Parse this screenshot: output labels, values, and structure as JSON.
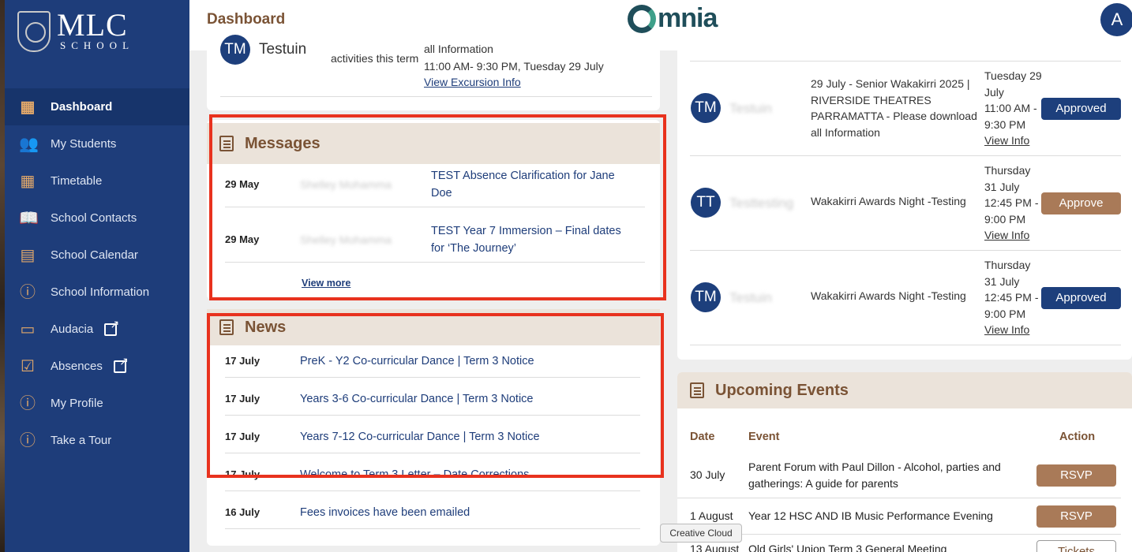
{
  "app": {
    "logo_main": "MLC",
    "logo_sub": "SCHOOL",
    "page_title": "Dashboard",
    "brand": "mnia",
    "avatar_initial": "A"
  },
  "sidebar": {
    "items": [
      {
        "label": "Dashboard",
        "icon": "dashboard-icon",
        "glyph": "▦"
      },
      {
        "label": "My Students",
        "icon": "students-icon",
        "glyph": "👥"
      },
      {
        "label": "Timetable",
        "icon": "timetable-icon",
        "glyph": "▦"
      },
      {
        "label": "School Contacts",
        "icon": "contacts-icon",
        "glyph": "📖"
      },
      {
        "label": "School Calendar",
        "icon": "calendar-icon",
        "glyph": "▤"
      },
      {
        "label": "School Information",
        "icon": "info-icon",
        "glyph": "ⓘ"
      },
      {
        "label": "Audacia",
        "icon": "audacia-icon",
        "glyph": "▭"
      },
      {
        "label": "Absences",
        "icon": "absences-icon",
        "glyph": "☑"
      },
      {
        "label": "My Profile",
        "icon": "profile-icon",
        "glyph": "ⓘ"
      },
      {
        "label": "Take a Tour",
        "icon": "tour-icon",
        "glyph": "ⓘ"
      }
    ]
  },
  "top_card": {
    "avatar": "TM",
    "name": "Testuin",
    "col1": "activities this term",
    "line1": "all Information",
    "line2": "11:00 AM- 9:30 PM, Tuesday 29 July",
    "link": "View Excursion Info"
  },
  "messages": {
    "title": "Messages",
    "items": [
      {
        "date": "29 May",
        "sender": "Shelley Mohamma",
        "subject": "TEST Absence Clarification for Jane Doe"
      },
      {
        "date": "29 May",
        "sender": "Shelley Mohamma",
        "subject": "TEST Year 7 Immersion – Final dates for ‘The Journey’"
      }
    ],
    "view_more": "View more"
  },
  "news": {
    "title": "News",
    "items": [
      {
        "date": "17 July",
        "title": "PreK - Y2 Co-curricular Dance | Term 3 Notice"
      },
      {
        "date": "17 July",
        "title": "Years 3-6 Co-curricular Dance | Term 3 Notice"
      },
      {
        "date": "17 July",
        "title": "Years 7-12 Co-curricular Dance | Term 3 Notice"
      },
      {
        "date": "17 July",
        "title": "Welcome to Term 3 Letter – Date Corrections"
      },
      {
        "date": "16 July",
        "title": "Fees invoices have been emailed"
      }
    ]
  },
  "approvals": {
    "items": [
      {
        "avatar": "TM",
        "name": "Testuin",
        "event": "29 July - Senior Wakakirri 2025 | RIVERSIDE THEATRES PARRAMATTA - Please download all Information",
        "when": [
          "Tuesday 29",
          "July",
          "11:00 AM -",
          "9:30 PM"
        ],
        "link": "View Info",
        "action": "Approved"
      },
      {
        "avatar": "TT",
        "name": "Testtesting",
        "event": "Wakakirri Awards Night -Testing",
        "when": [
          "Thursday",
          "31 July",
          "12:45 PM -",
          "9:00 PM"
        ],
        "link": "View Info",
        "action": "Approve"
      },
      {
        "avatar": "TM",
        "name": "Testuin",
        "event": "Wakakirri Awards Night -Testing",
        "when": [
          "Thursday",
          "31 July",
          "12:45 PM -",
          "9:00 PM"
        ],
        "link": "View Info",
        "action": "Approved"
      }
    ]
  },
  "events": {
    "title": "Upcoming Events",
    "headers": {
      "date": "Date",
      "event": "Event",
      "action": "Action"
    },
    "items": [
      {
        "date": "30 July",
        "event": "Parent Forum with Paul Dillon - Alcohol, parties and gatherings: A guide for parents",
        "action": "RSVP"
      },
      {
        "date": "1 August",
        "event": "Year 12 HSC AND IB Music Performance Evening",
        "action": "RSVP"
      },
      {
        "date": "13 August",
        "event": "Old Girls' Union Term 3 General Meeting",
        "action": "Tickets"
      }
    ]
  },
  "tooltip": "Creative Cloud"
}
